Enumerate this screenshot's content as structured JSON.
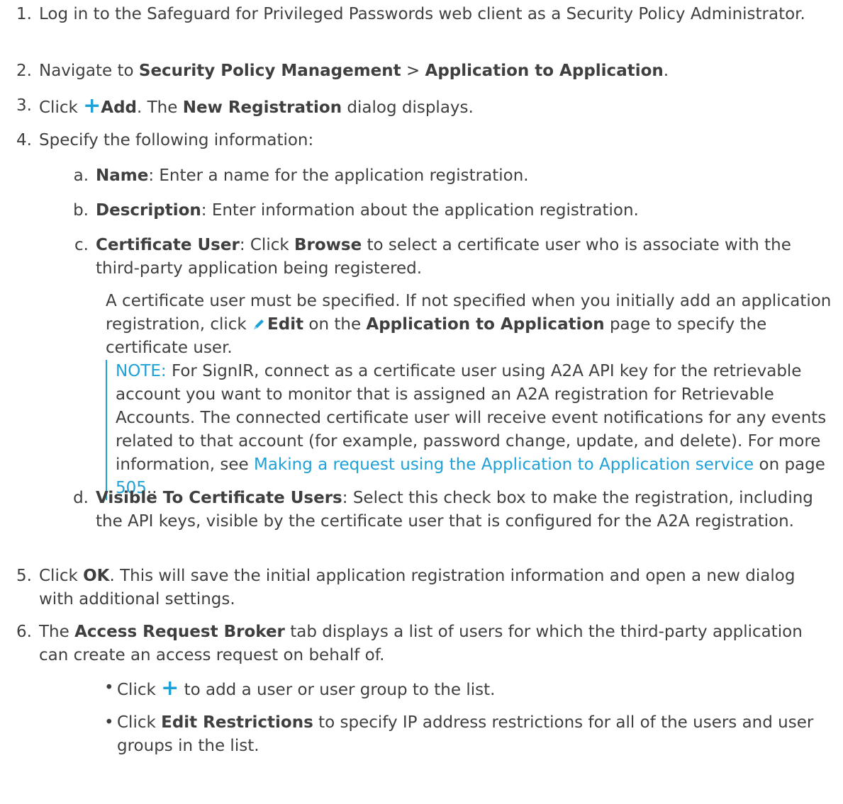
{
  "steps": [
    {
      "num": "1.",
      "text": "Log in to the Safeguard for Privileged Passwords web client as a Security Policy Administrator."
    },
    {
      "num": "2.",
      "pre": "Navigate to ",
      "b1": "Security Policy Management",
      "mid": " > ",
      "b2": "Application to Application",
      "post": "."
    },
    {
      "num": "3.",
      "pre": "Click ",
      "icon": "+",
      "b1": "Add",
      "mid": ". The ",
      "b2": "New Registration",
      "post": " dialog displays."
    },
    {
      "num": "4.",
      "text": "Specify the following information:"
    },
    {
      "num": "5.",
      "pre": "Click ",
      "b1": "OK",
      "post": ". This will save the initial application registration information and open a new dialog with additional settings."
    },
    {
      "num": "6.",
      "pre": "The ",
      "b1": "Access Request Broker",
      "post": " tab displays a list of users for which the third-party application can create an access request on behalf of."
    }
  ],
  "substeps": [
    {
      "letter": "a.",
      "label": "Name",
      "text": ": Enter a name for the application registration."
    },
    {
      "letter": "b.",
      "label": "Description",
      "text": ": Enter information about the application registration."
    },
    {
      "letter": "c.",
      "label": "Certificate User",
      "pre": ": Click ",
      "b": "Browse",
      "text": " to select a certificate user who is associate with the third-party application being registered."
    },
    {
      "letter": "d.",
      "label": "Visible To Certificate Users",
      "text": ": Select this check box to make the registration, including the API keys, visible by the certificate user that is configured for the A2A registration."
    }
  ],
  "cert_para": {
    "pre": "A certificate user must be specified. If not specified when you initially add an application registration, click ",
    "edit": "Edit",
    "mid": " on the ",
    "b": "Application to Application",
    "post": " page to specify the certificate user."
  },
  "note": {
    "label": "NOTE:",
    "text": " For SignIR, connect as a certificate user using A2A API key for the retrievable account you want to monitor that is assigned an A2A registration for Retrievable Accounts. The connected certificate user will receive event notifications for any events related to that account (for example, password change, update, and delete). For more information, see ",
    "link": "Making a request using the Application to Application service",
    "mid": " on page ",
    "page": "505",
    "post": ".."
  },
  "bullets": [
    {
      "pre": "Click ",
      "icon": "+",
      "post": " to add a user or user group to the list."
    },
    {
      "pre": "Click ",
      "b": "Edit Restrictions",
      "post": " to specify IP address restrictions for all of the users and user groups in the list."
    }
  ],
  "colors": {
    "accent": "#1ea1d7",
    "text": "#3f3f3f"
  },
  "icons": {
    "plus": "plus-icon",
    "edit": "pencil-icon",
    "bullet": "bullet-dot"
  }
}
